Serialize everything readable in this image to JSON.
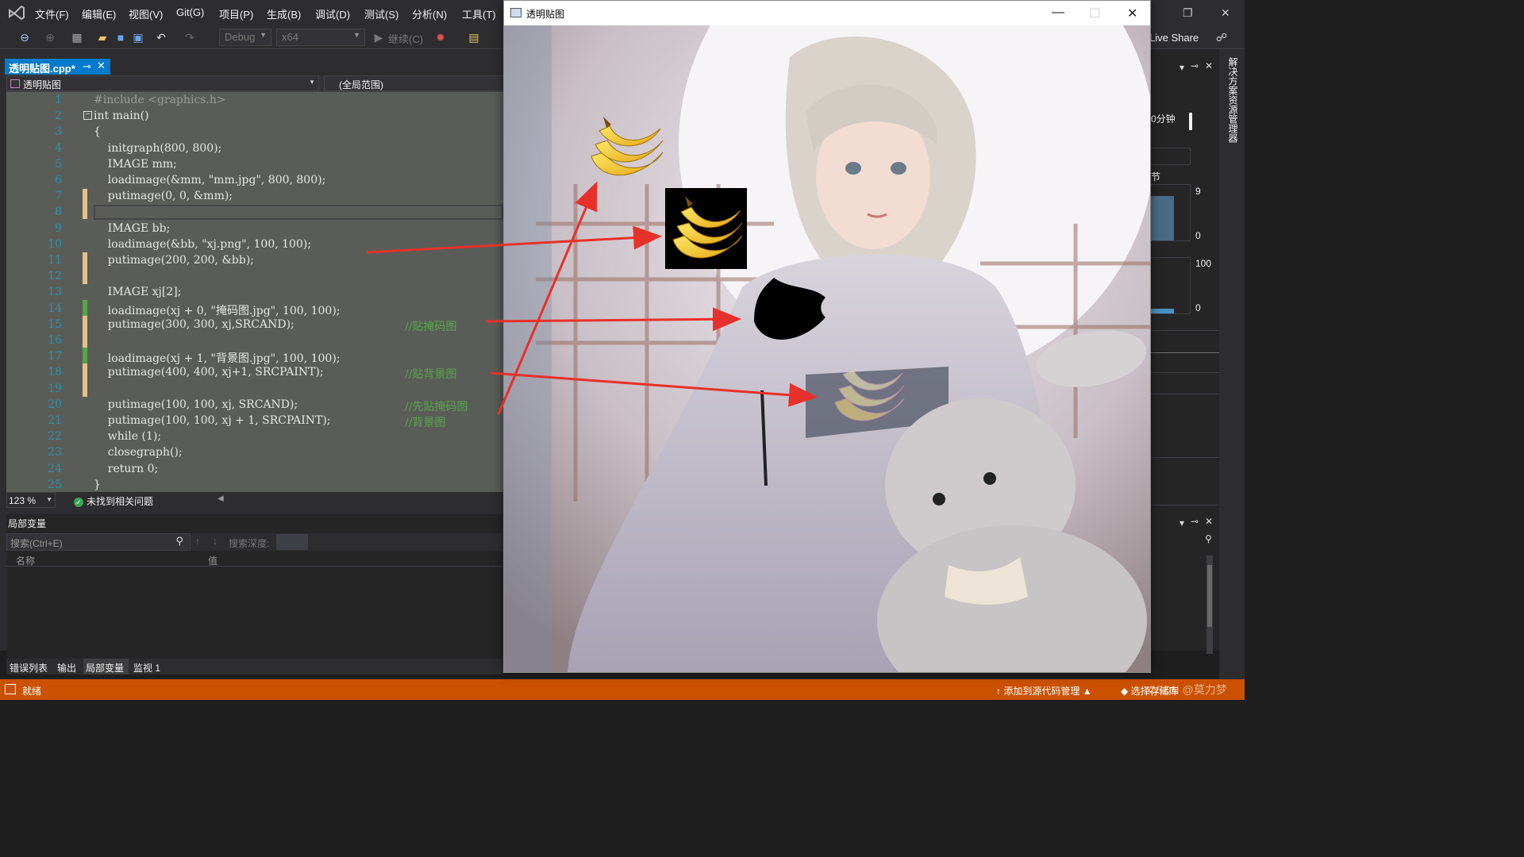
{
  "menubar": {
    "items": [
      "文件(F)",
      "编辑(E)",
      "视图(V)",
      "Git(G)",
      "项目(P)",
      "生成(B)",
      "调试(D)",
      "测试(S)",
      "分析(N)",
      "工具(T)"
    ]
  },
  "toolbar": {
    "config": "Debug",
    "platform": "x64",
    "continue_label": "继续(C)",
    "live_share": "Live Share"
  },
  "editor": {
    "tab_title": "透明贴图.cpp*",
    "nav_project": "透明贴图",
    "nav_scope": "(全局范围)",
    "line_numbers": [
      "1",
      "2",
      "3",
      "4",
      "5",
      "6",
      "7",
      "8",
      "9",
      "10",
      "11",
      "12",
      "13",
      "14",
      "15",
      "16",
      "17",
      "18",
      "19",
      "20",
      "21",
      "22",
      "23",
      "24",
      "25"
    ],
    "lines": [
      "#include <graphics.h>",
      "int main()",
      "{",
      "    initgraph(800, 800);",
      "    IMAGE mm;",
      "    loadimage(&mm, \"mm.jpg\", 800, 800);",
      "    putimage(0, 0, &mm);",
      "",
      "    IMAGE bb;",
      "    loadimage(&bb, \"xj.png\", 100, 100);",
      "    putimage(200, 200, &bb);",
      "",
      "    IMAGE xj[2];",
      "    loadimage(xj + 0, \"掩码图.jpg\", 100, 100);",
      "    putimage(300, 300, xj,SRCAND);",
      "",
      "    loadimage(xj + 1, \"背景图.jpg\", 100, 100);",
      "    putimage(400, 400, xj+1, SRCPAINT);",
      "",
      "    putimage(100, 100, xj, SRCAND);",
      "    putimage(100, 100, xj + 1, SRCPAINT);",
      "    while (1);",
      "    closegraph();",
      "    return 0;",
      "}"
    ],
    "comments": {
      "l15": "//贴掩码图",
      "l18": "//贴背景图",
      "l20": "//先贴掩码图",
      "l21": "//背景图"
    },
    "zoom": "123 %",
    "issues": "未找到相关问题"
  },
  "locals": {
    "title": "局部变量",
    "search_placeholder": "搜索(Ctrl+E)",
    "depth_label": "搜索深度:",
    "col_name": "名称",
    "col_value": "值"
  },
  "bottom_tabs": [
    "错误列表",
    "输出",
    "局部变量",
    "监视 1"
  ],
  "right_pane": {
    "vertical_tab": "解决方案资源管理器",
    "time_label": "0分钟",
    "section": "节",
    "axis": [
      "9",
      "0",
      "100",
      "0"
    ]
  },
  "statusbar": {
    "ready": "就绪",
    "add_source": "添加到源代码管理",
    "select_repo": "选择存储库",
    "watermark": "CSDN @莫力梦"
  },
  "popup": {
    "title": "透明贴图"
  },
  "colors": {
    "accent": "#007acc",
    "statusbar": "#ca5100",
    "arrow": "#e8302a"
  }
}
